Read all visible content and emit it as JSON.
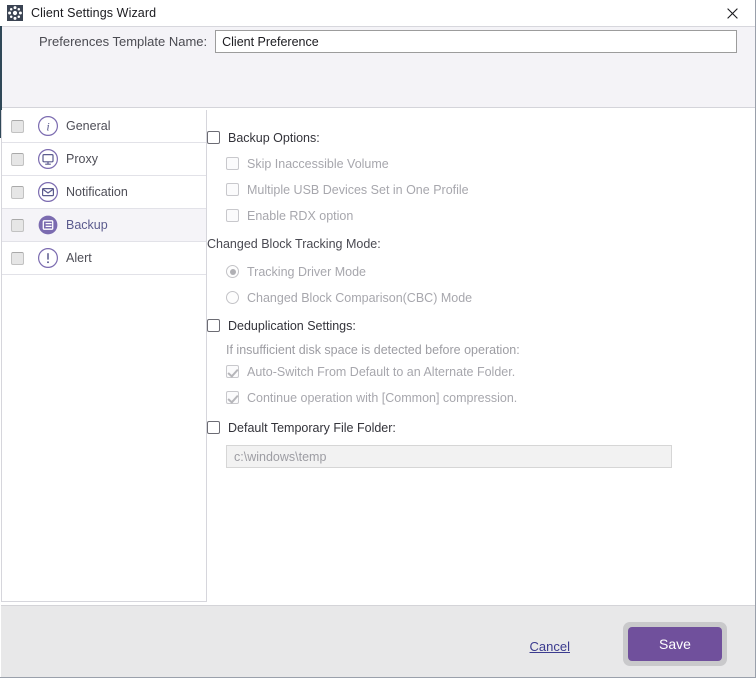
{
  "window": {
    "title": "Client Settings Wizard",
    "app_icon": "molecule-icon",
    "close_icon": "close-icon"
  },
  "header": {
    "template_label": "Preferences Template Name:",
    "template_value": "Client Preference",
    "template_placeholder": ""
  },
  "sidebar": {
    "items": [
      {
        "label": "General",
        "icon": "info-circle-icon",
        "selected": false,
        "checked": false
      },
      {
        "label": "Proxy",
        "icon": "monitor-circle-icon",
        "selected": false,
        "checked": false
      },
      {
        "label": "Notification",
        "icon": "envelope-circle-icon",
        "selected": false,
        "checked": false
      },
      {
        "label": "Backup",
        "icon": "document-circle-icon",
        "selected": true,
        "checked": false
      },
      {
        "label": "Alert",
        "icon": "exclamation-circle-icon",
        "selected": false,
        "checked": false
      }
    ]
  },
  "main": {
    "backup_options": {
      "label": "Backup Options:",
      "checked": false,
      "enabled": true,
      "items": [
        {
          "label": "Skip Inaccessible Volume",
          "checked": false,
          "enabled": false
        },
        {
          "label": "Multiple USB Devices Set in One Profile",
          "checked": false,
          "enabled": false
        },
        {
          "label": "Enable RDX option",
          "checked": false,
          "enabled": false
        }
      ]
    },
    "cbt": {
      "label": "Changed Block Tracking Mode:",
      "options": [
        {
          "label": "Tracking Driver Mode",
          "selected": true,
          "enabled": false
        },
        {
          "label": "Changed Block Comparison(CBC) Mode",
          "selected": false,
          "enabled": false
        }
      ]
    },
    "dedup": {
      "label": "Deduplication Settings:",
      "checked": false,
      "enabled": true,
      "note": "If insufficient disk space is detected before operation:",
      "items": [
        {
          "label": "Auto-Switch From Default to an Alternate Folder.",
          "checked": true,
          "enabled": false
        },
        {
          "label": "Continue operation with [Common] compression.",
          "checked": true,
          "enabled": false
        }
      ]
    },
    "temp_folder": {
      "label": "Default Temporary File Folder:",
      "checked": false,
      "enabled": true,
      "value": "c:\\windows\\temp",
      "placeholder": ""
    }
  },
  "footer": {
    "cancel_label": "Cancel",
    "save_label": "Save"
  },
  "colors": {
    "accent_purple": "#70509c",
    "icon_purple": "#7b6bb0",
    "link_blue": "#3b3b8f",
    "header_band": "#f4f3f7",
    "footer_gray": "#e8e8e9"
  }
}
